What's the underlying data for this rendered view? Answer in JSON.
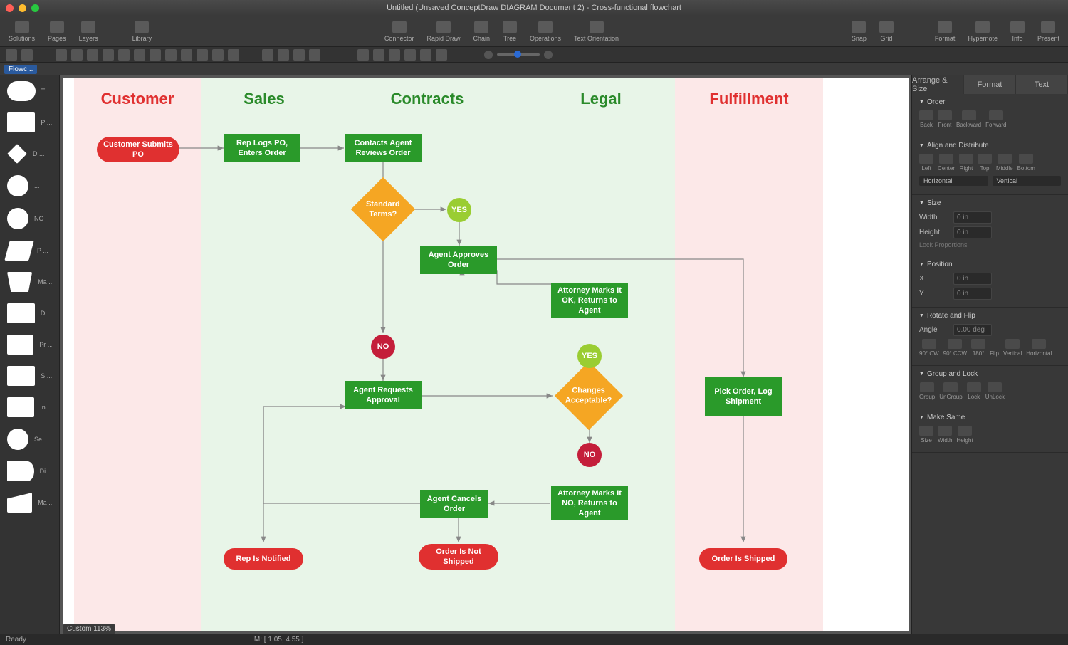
{
  "window": {
    "title": "Untitled (Unsaved ConceptDraw DIAGRAM Document 2) - Cross-functional flowchart"
  },
  "toolbar": {
    "left": [
      {
        "label": "Solutions"
      },
      {
        "label": "Pages"
      },
      {
        "label": "Layers"
      },
      {
        "label": "Library"
      }
    ],
    "center": [
      {
        "label": "Connector"
      },
      {
        "label": "Rapid Draw"
      },
      {
        "label": "Chain"
      },
      {
        "label": "Tree"
      },
      {
        "label": "Operations"
      },
      {
        "label": "Text Orientation"
      }
    ],
    "rightA": [
      {
        "label": "Snap"
      },
      {
        "label": "Grid"
      }
    ],
    "rightB": [
      {
        "label": "Format"
      },
      {
        "label": "Hypernote"
      },
      {
        "label": "Info"
      },
      {
        "label": "Present"
      }
    ]
  },
  "library": {
    "selected": "Flowc..."
  },
  "shapes": [
    {
      "label": "T ..."
    },
    {
      "label": "P ..."
    },
    {
      "label": "D ..."
    },
    {
      "label": "..."
    },
    {
      "label": "NO"
    },
    {
      "label": "P ..."
    },
    {
      "label": "Ma ..."
    },
    {
      "label": "D ..."
    },
    {
      "label": "Pr ..."
    },
    {
      "label": "S ..."
    },
    {
      "label": "In ..."
    },
    {
      "label": "Se ..."
    },
    {
      "label": "Di ..."
    },
    {
      "label": "Ma ..."
    }
  ],
  "lanes": {
    "customer": "Customer",
    "sales": "Sales",
    "contracts": "Contracts",
    "legal": "Legal",
    "fulfillment": "Fulfillment"
  },
  "nodes": {
    "submit": "Customer Submits PO",
    "replogs": "Rep Logs PO, Enters Order",
    "reviews": "Contacts Agent Reviews Order",
    "stdterms": "Standard Terms?",
    "yes1": "YES",
    "approves": "Agent Approves Order",
    "no1": "NO",
    "requests": "Agent Requests Approval",
    "changes": "Changes Acceptable?",
    "yes2": "YES",
    "atnok": "Attorney Marks It OK, Returns to Agent",
    "no2": "NO",
    "atnno": "Attorney Marks It NO, Returns to Agent",
    "cancel": "Agent Cancels Order",
    "repnot": "Rep Is Notified",
    "notship": "Order Is Not Shipped",
    "pick": "Pick Order, Log Shipment",
    "shipped": "Order Is Shipped"
  },
  "inspector": {
    "tabs": {
      "arrange": "Arrange & Size",
      "format": "Format",
      "text": "Text"
    },
    "order": {
      "title": "Order",
      "back": "Back",
      "front": "Front",
      "backward": "Backward",
      "forward": "Forward"
    },
    "align": {
      "title": "Align and Distribute",
      "left": "Left",
      "center": "Center",
      "right": "Right",
      "top": "Top",
      "middle": "Middle",
      "bottom": "Bottom",
      "horiz": "Horizontal",
      "vert": "Vertical"
    },
    "size": {
      "title": "Size",
      "width": "Width",
      "wval": "0 in",
      "height": "Height",
      "hval": "0 in",
      "lock": "Lock Proportions"
    },
    "pos": {
      "title": "Position",
      "x": "X",
      "xval": "0 in",
      "y": "Y",
      "yval": "0 in"
    },
    "rot": {
      "title": "Rotate and Flip",
      "angle": "Angle",
      "aval": "0.00 deg",
      "cw": "90° CW",
      "ccw": "90° CCW",
      "r180": "180°",
      "flip": "Flip",
      "v": "Vertical",
      "h": "Horizontal"
    },
    "grp": {
      "title": "Group and Lock",
      "group": "Group",
      "ungroup": "UnGroup",
      "lock": "Lock",
      "unlock": "UnLock"
    },
    "same": {
      "title": "Make Same",
      "size": "Size",
      "width": "Width",
      "height": "Height"
    }
  },
  "zoom": "Custom 113%",
  "status": {
    "ready": "Ready",
    "mouse": "M: [ 1.05, 4.55 ]"
  }
}
